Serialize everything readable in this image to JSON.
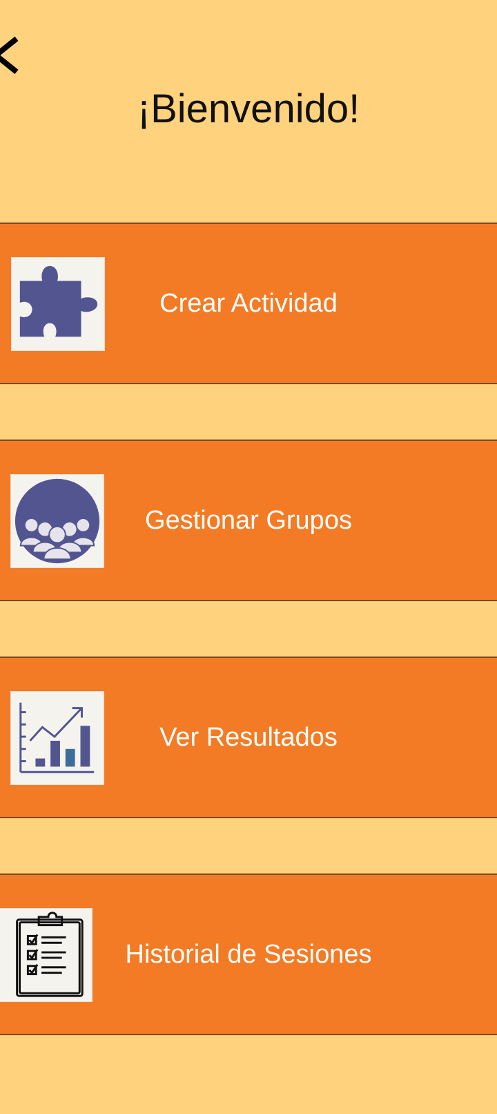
{
  "header": {
    "title": "¡Bienvenido!",
    "back_icon": "chevron-left-icon"
  },
  "menu": [
    {
      "label": "Crear Actividad",
      "icon": "puzzle-piece-icon"
    },
    {
      "label": "Gestionar Grupos",
      "icon": "group-people-icon"
    },
    {
      "label": "Ver Resultados",
      "icon": "bar-chart-trend-icon"
    },
    {
      "label": "Historial de Sesiones",
      "icon": "clipboard-checklist-icon"
    }
  ],
  "colors": {
    "background": "#FFD27D",
    "button": "#F47B25",
    "icon_accent": "#535591",
    "text_light": "#FFFFFF"
  }
}
